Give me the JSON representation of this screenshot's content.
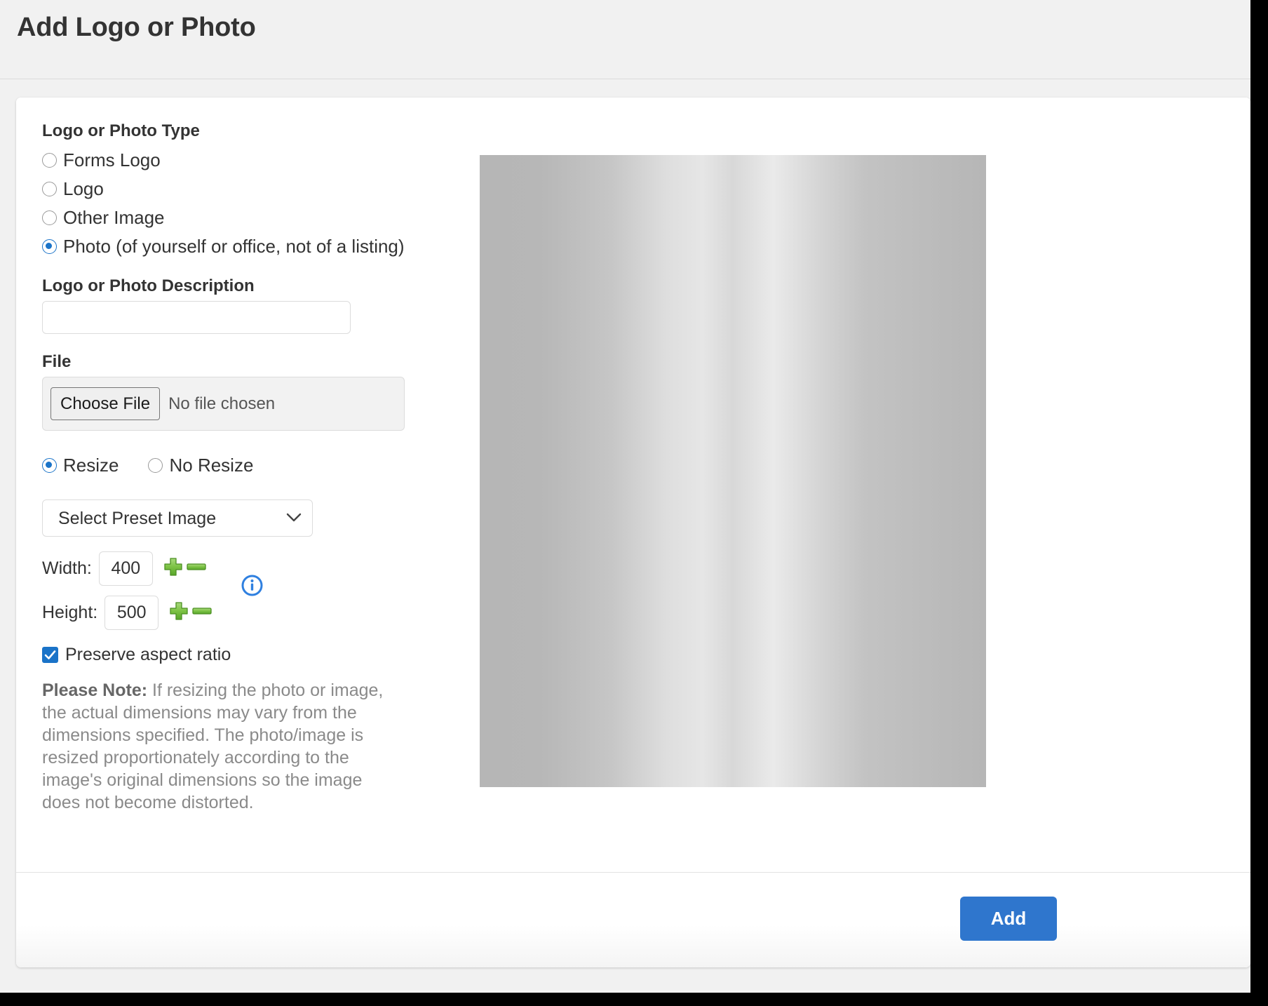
{
  "header": {
    "title": "Add Logo or Photo"
  },
  "form": {
    "type_group": {
      "label": "Logo or Photo Type",
      "options": [
        {
          "label": "Forms Logo",
          "checked": false
        },
        {
          "label": "Logo",
          "checked": false
        },
        {
          "label": "Other Image",
          "checked": false
        },
        {
          "label": "Photo (of yourself or office, not of a listing)",
          "checked": true
        }
      ]
    },
    "description": {
      "label": "Logo or Photo Description",
      "value": "",
      "placeholder": ""
    },
    "file": {
      "label": "File",
      "choose_button": "Choose File",
      "status": "No file chosen"
    },
    "resize_group": {
      "options": [
        {
          "label": "Resize",
          "checked": true
        },
        {
          "label": "No Resize",
          "checked": false
        }
      ]
    },
    "preset_select": {
      "selected": "Select Preset Image",
      "options": [
        "Select Preset Image"
      ],
      "icon": "chevron-down-icon"
    },
    "width": {
      "label": "Width:",
      "value": "400",
      "increment_icon": "plus-icon",
      "decrement_icon": "minus-icon"
    },
    "height": {
      "label": "Height:",
      "value": "500",
      "increment_icon": "plus-icon",
      "decrement_icon": "minus-icon"
    },
    "info_icon": "info-icon",
    "preserve_aspect": {
      "label": "Preserve aspect ratio",
      "checked": true
    },
    "note": {
      "strong": "Please Note:",
      "text": " If resizing the photo or image, the actual dimensions may vary from the dimensions specified. The photo/image is resized proportionately according to the image's original dimensions so the image does not become distorted."
    }
  },
  "preview": {
    "alt": "image-preview"
  },
  "footer": {
    "add_label": "Add"
  },
  "colors": {
    "accent_blue": "#2f76cd",
    "radio_blue": "#1a73c8",
    "plus_green": "#6fbf3c",
    "info_blue": "#2f80e0",
    "page_bg": "#f1f1f1",
    "card_bg": "#ffffff"
  }
}
